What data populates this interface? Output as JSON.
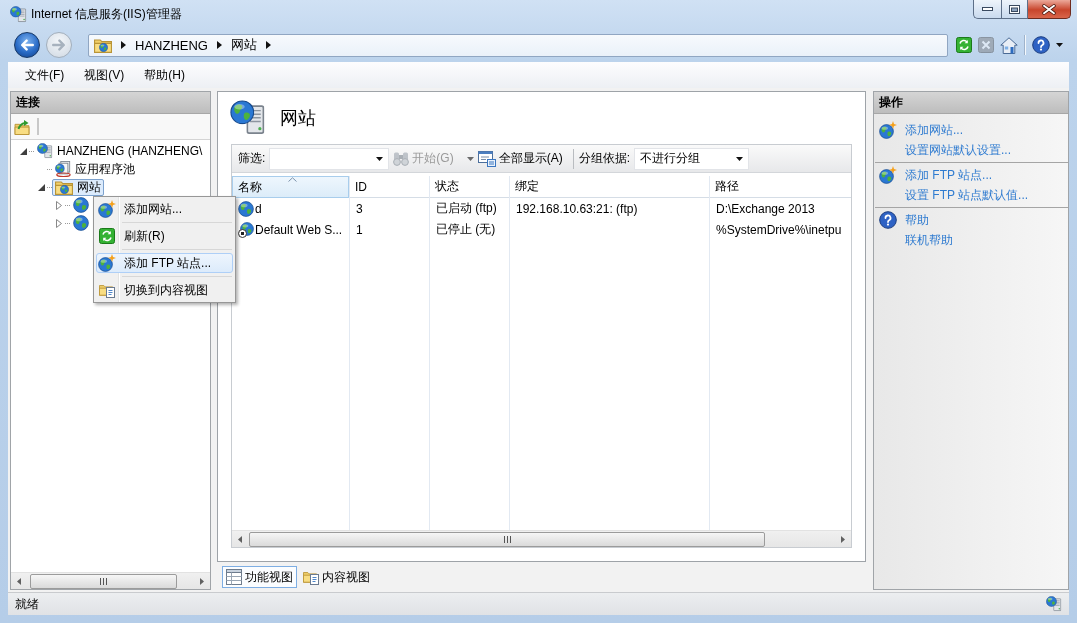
{
  "window": {
    "title": "Internet 信息服务(IIS)管理器"
  },
  "nav_buttons": [
    {
      "kind": "back",
      "disabled": false
    },
    {
      "kind": "forward",
      "disabled": true
    }
  ],
  "address_bar": {
    "breadcrumbs": [
      "HANZHENG",
      "网站"
    ]
  },
  "toolbar_buttons": [
    {
      "kind": "refresh",
      "disabled": false
    },
    {
      "kind": "stop",
      "disabled": true
    },
    {
      "kind": "home",
      "disabled": false
    },
    {
      "kind": "help",
      "disabled": false
    }
  ],
  "menu": [
    "文件(F)",
    "视图(V)",
    "帮助(H)"
  ],
  "connections": {
    "title": "连接",
    "tree": [
      {
        "label": "HANZHENG (HANZHENG\\",
        "kind": "server",
        "expanded": true,
        "selected": false,
        "children": [
          {
            "label": "应用程序池",
            "kind": "app-pools",
            "selected": false
          },
          {
            "label": "网站",
            "kind": "sites",
            "expanded": true,
            "selected": true,
            "children": [
              {
                "kind": "site",
                "expanded": false,
                "selected": false
              },
              {
                "kind": "site",
                "expanded": false,
                "selected": false
              }
            ]
          }
        ]
      }
    ]
  },
  "context_menu": {
    "items": [
      {
        "label": "添加网站...",
        "kind": "add",
        "selected": false
      },
      {
        "label": "刷新(R)",
        "kind": "refresh",
        "selected": false
      },
      {
        "label": "添加 FTP 站点...",
        "kind": "add",
        "selected": true
      },
      {
        "label": "切换到内容视图",
        "kind": "content-view",
        "selected": false
      }
    ]
  },
  "page": {
    "title": "网站",
    "filter": {
      "label": "筛选:"
    },
    "start_button": {
      "label": "开始(G)",
      "disabled": true
    },
    "show_all_button": {
      "label": "全部显示(A)"
    },
    "group_by": {
      "label": "分组依据:",
      "value": "不进行分组"
    }
  },
  "table": {
    "columns": [
      {
        "label": "名称",
        "sorted": true
      },
      {
        "label": "ID",
        "sorted": false
      },
      {
        "label": "状态",
        "sorted": false
      },
      {
        "label": "绑定",
        "sorted": false
      },
      {
        "label": "路径",
        "sorted": false
      }
    ],
    "rows": [
      {
        "running": true,
        "name": "d",
        "id": "3",
        "status": "已启动 (ftp)",
        "binding": "192.168.10.63:21: (ftp)",
        "path": "D:\\Exchange 2013"
      },
      {
        "running": false,
        "name": "Default Web S...",
        "id": "1",
        "status": "已停止 (无)",
        "path": "%SystemDrive%\\inetpu"
      }
    ]
  },
  "view_tabs": [
    {
      "label": "功能视图",
      "kind": "features",
      "selected": true
    },
    {
      "label": "内容视图",
      "kind": "content",
      "selected": false
    }
  ],
  "actions": {
    "title": "操作",
    "groups": [
      {
        "items": [
          {
            "label": "添加网站...",
            "kind": "add"
          },
          {
            "label": "设置网站默认设置...",
            "kind": "link"
          }
        ]
      },
      {
        "items": [
          {
            "label": "添加 FTP 站点...",
            "kind": "add"
          },
          {
            "label": "设置 FTP 站点默认值...",
            "kind": "link"
          }
        ]
      },
      {
        "items": [
          {
            "label": "帮助",
            "kind": "help"
          },
          {
            "label": "联机帮助",
            "kind": "link"
          }
        ]
      }
    ]
  },
  "status_bar": {
    "text": "就绪"
  }
}
